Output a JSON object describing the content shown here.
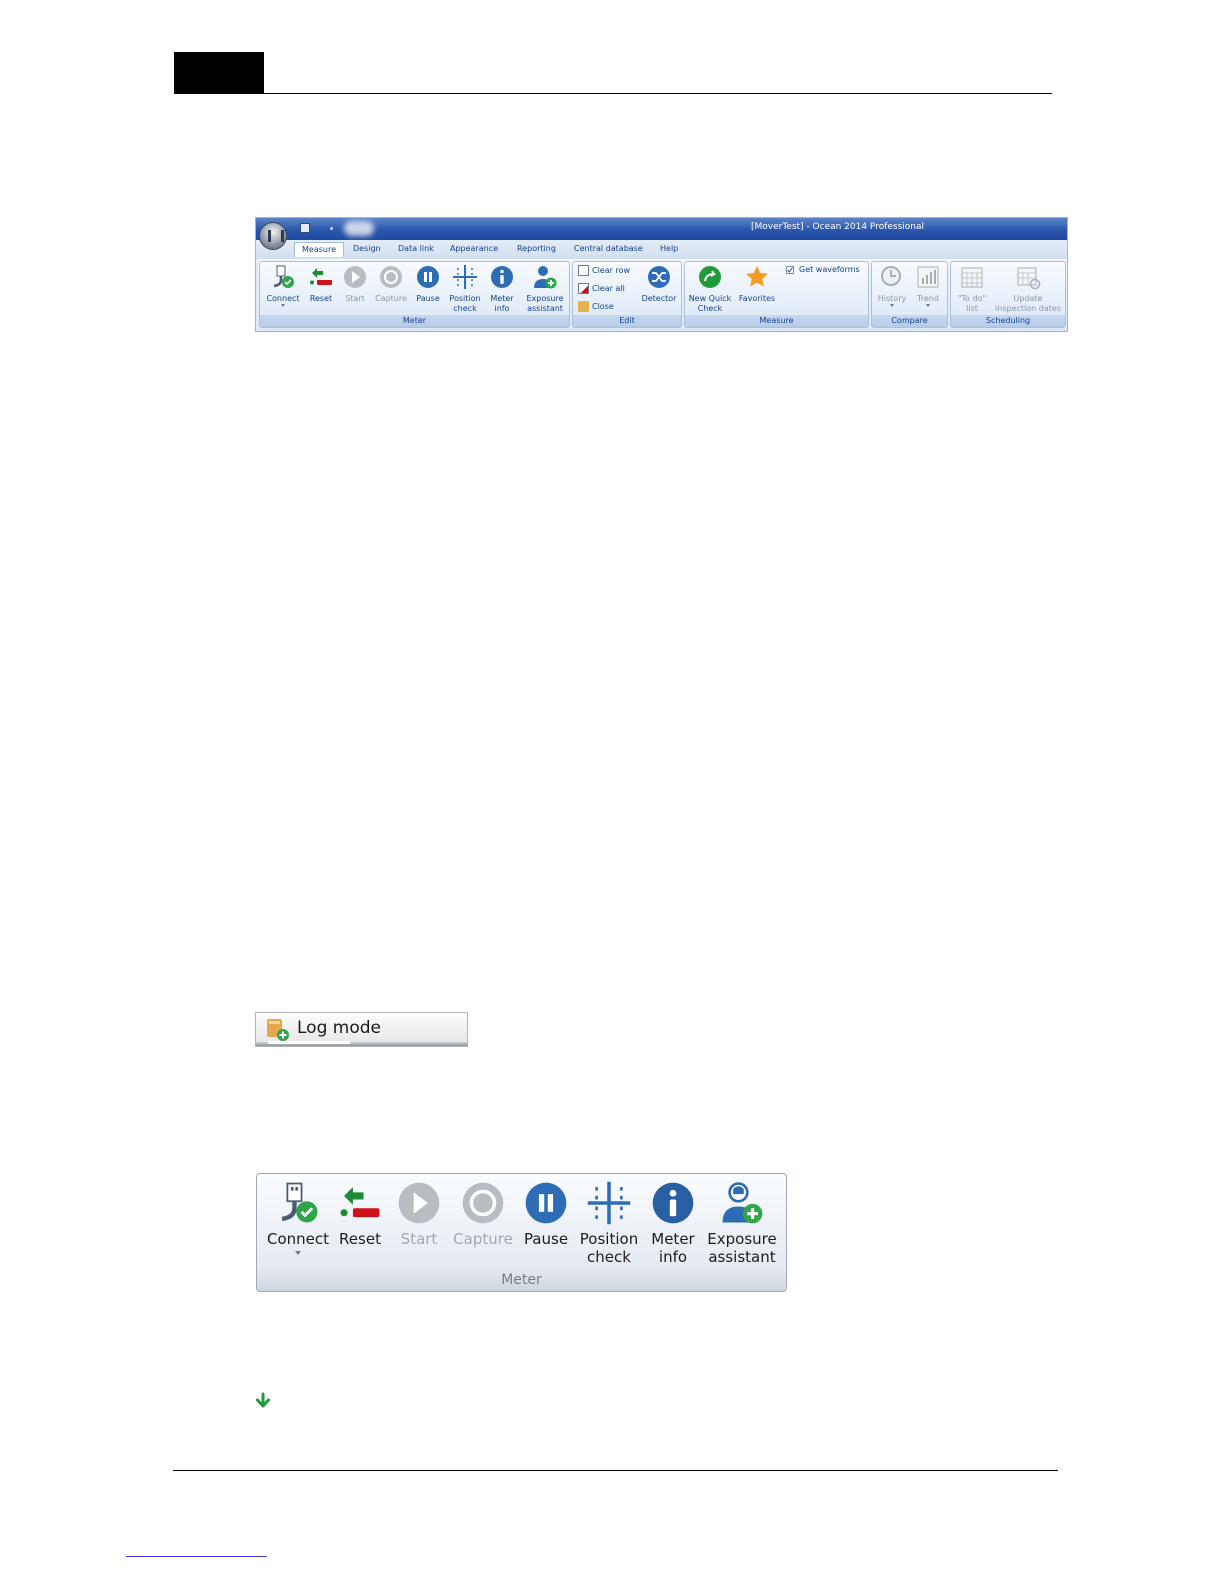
{
  "ribbon": {
    "title": "[MoverTest] - Ocean 2014 Professional",
    "tabs": [
      "Measure",
      "Design",
      "Data link",
      "Appearance",
      "Reporting",
      "Central database",
      "Help"
    ],
    "meter_group": {
      "label": "Meter",
      "buttons": [
        "Connect",
        "Reset",
        "Start",
        "Capture",
        "Pause",
        "Position check",
        "Meter info",
        "Exposure assistant"
      ]
    },
    "edit_group": {
      "label": "Edit",
      "items": [
        "Clear row",
        "Clear all",
        "Close"
      ],
      "detector": "Detector"
    },
    "measure_group": {
      "label": "Measure",
      "new_quick_check": "New Quick Check",
      "favorites": "Favorites",
      "get_waveforms": "Get waveforms",
      "get_waveforms_checked": true
    },
    "compare_group": {
      "label": "Compare",
      "buttons": [
        "History",
        "Trend"
      ]
    },
    "scheduling_group": {
      "label": "Scheduling",
      "todo_list": "\"To do\" list",
      "update_inspection_dates": "Update inspection dates"
    }
  },
  "log_mode": {
    "label": "Log mode"
  },
  "meter_zoom": {
    "group_label": "Meter",
    "buttons": {
      "connect": [
        "Connect"
      ],
      "reset": [
        "Reset"
      ],
      "start": [
        "Start"
      ],
      "capture": [
        "Capture"
      ],
      "pause": [
        "Pause"
      ],
      "position_check": [
        "Position",
        "check"
      ],
      "meter_info": [
        "Meter",
        "info"
      ],
      "exposure_assistant": [
        "Exposure",
        "assistant"
      ]
    }
  },
  "colors": {
    "blue_icon": "#2e6db4",
    "green_icon": "#1f9b3a",
    "red_bar": "#d0111b",
    "disabled_gray": "#a8aeb6",
    "orange_star": "#f39c23"
  }
}
